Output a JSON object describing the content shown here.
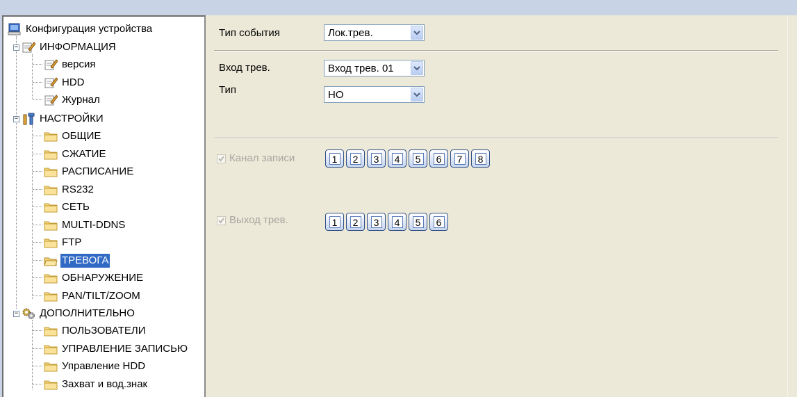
{
  "tree": {
    "root": "Конфигурация устройства",
    "groups": [
      {
        "label": "ИНФОРМАЦИЯ",
        "icon": "notepad-pencil-icon",
        "items": [
          "версия",
          "HDD",
          "Журнал"
        ]
      },
      {
        "label": "НАСТРОЙКИ",
        "icon": "tools-icon",
        "items": [
          "ОБЩИЕ",
          "СЖАТИЕ",
          "РАСПИСАНИЕ",
          "RS232",
          "СЕТЬ",
          "MULTI-DDNS",
          "FTP",
          "ТРЕВОГА",
          "ОБНАРУЖЕНИЕ",
          "PAN/TILT/ZOOM"
        ]
      },
      {
        "label": "ДОПОЛНИТЕЛЬНО",
        "icon": "gears-icon",
        "items": [
          "ПОЛЬЗОВАТЕЛИ",
          "УПРАВЛЕНИЕ ЗАПИСЬЮ",
          "Управление HDD",
          "Захват и вод.знак"
        ]
      }
    ],
    "selected": "ТРЕВОГА"
  },
  "form": {
    "event_type_label": "Тип события",
    "event_type_value": "Лок.трев.",
    "alarm_input_label": "Вход трев.",
    "alarm_input_value": "Вход трев. 01",
    "type_label": "Тип",
    "type_value": "НО",
    "record_channel_label": "Канал записи",
    "record_channels": [
      "1",
      "2",
      "3",
      "4",
      "5",
      "6",
      "7",
      "8"
    ],
    "alarm_output_label": "Выход трев.",
    "alarm_outputs": [
      "1",
      "2",
      "3",
      "4",
      "5",
      "6"
    ]
  },
  "colors": {
    "selection": "#316ac5",
    "panel": "#ece9d8",
    "frame": "#c9d3e6"
  }
}
